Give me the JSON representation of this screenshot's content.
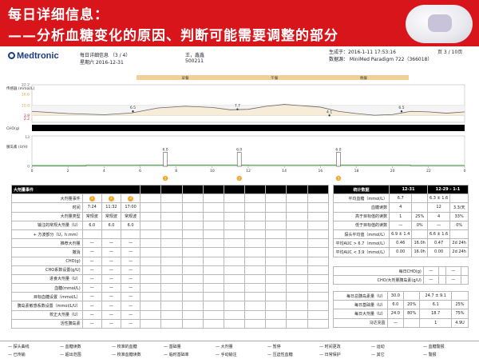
{
  "banner": {
    "line1": "每日详细信息：",
    "line2": "——分析血糖变化的原因、判断可能需要调整的部分"
  },
  "header": {
    "logo": "Medtronic",
    "report_title": "每日详细信息 （3 / 4）",
    "weekday_date": "星期六  2016-12-31",
    "patient_name": "王，鑫鑫",
    "patient_id": "500211",
    "generated": "生成于：2016-1-11 17:53:16",
    "page": "页 3 / 10页",
    "data_source": "数据源：  MiniMed Paradigm 722（366018）"
  },
  "chart_data": {
    "type": "line",
    "meal_bands": [
      "早餐",
      "午餐",
      "晚餐"
    ],
    "sg_ylabel": "传感器 (mmol/L)",
    "sg_ticks": [
      "22.2",
      "16.6",
      "10.0",
      "3.9",
      "2.2"
    ],
    "sg_ylim": [
      0,
      22.2
    ],
    "sg_x": [
      0,
      2,
      4,
      5.5,
      7,
      8.5,
      10,
      11,
      12,
      13,
      14,
      16,
      17,
      18,
      19,
      20,
      21,
      22,
      23,
      24
    ],
    "sg_y": [
      6.5,
      5.2,
      4.5,
      5.5,
      8.5,
      9.5,
      8.8,
      7.4,
      7.7,
      9.5,
      10.6,
      9.0,
      6.5,
      5.2,
      4.2,
      4.6,
      6.5,
      6.2,
      5.4,
      6.2
    ],
    "bg_points": [
      {
        "x": 5.6,
        "y": 6.5,
        "label": "6.5"
      },
      {
        "x": 11.4,
        "y": 7.7,
        "label": "7.7"
      },
      {
        "x": 16.5,
        "y": 4.1,
        "label": "4.1"
      },
      {
        "x": 20.5,
        "y": 6.5,
        "label": "6.5"
      }
    ],
    "carb_label": "CHO(g)",
    "insulin_ylabel": "胰岛素 (U/H)",
    "insulin_ticks": [
      "13",
      "0"
    ],
    "insulin_ylim": [
      0,
      13
    ],
    "basal": [
      0.3,
      0.3,
      0.3,
      0.45,
      0.45,
      0.45,
      0.55,
      0.55,
      0.55,
      0.5,
      0.5,
      0.5,
      0.45,
      0.45,
      0.45,
      0.45,
      0.55,
      0.55,
      0.5,
      0.5,
      0.5,
      0.35,
      0.35,
      0.35
    ],
    "boluses": [
      {
        "x": 7.4,
        "value": 6.0,
        "label": "6.0"
      },
      {
        "x": 11.5,
        "value": 6.0,
        "label": "6.0"
      },
      {
        "x": 17.0,
        "value": 6.0,
        "label": "6.0"
      }
    ],
    "x_ticks": [
      "0",
      "2",
      "4",
      "6",
      "8",
      "10",
      "12",
      "14",
      "16",
      "18",
      "20",
      "22",
      "0"
    ],
    "event_markers": [
      "1",
      "2",
      "3"
    ]
  },
  "left_table": {
    "title": "大剂量事件",
    "rows": [
      {
        "label": "大剂量事件",
        "v": [
          "1",
          "2",
          "3"
        ]
      },
      {
        "label": "时间",
        "v": [
          "7:24",
          "11:32",
          "17:00"
        ]
      },
      {
        "label": "大剂量类型",
        "v": [
          "常规波",
          "常规波",
          "常规波"
        ]
      },
      {
        "label": "输注的常规大剂量（U）",
        "v": [
          "6.0",
          "6.0",
          "6.0"
        ]
      },
      {
        "label": "+ 方波部分（U，h:mm）",
        "v": [
          "",
          "",
          ""
        ]
      },
      {
        "label": "推荐大剂量",
        "v": [
          "—",
          "—",
          "—"
        ]
      },
      {
        "label": "撤消",
        "v": [
          "—",
          "—",
          "—"
        ]
      },
      {
        "label": "CHO(g)",
        "v": [
          "—",
          "—",
          "—"
        ]
      },
      {
        "label": "CHO系数设置(g/U)",
        "v": [
          "—",
          "—",
          "—"
        ]
      },
      {
        "label": "进食大剂量（U）",
        "v": [
          "—",
          "—",
          "—"
        ]
      },
      {
        "label": "血糖(mmol/L)",
        "v": [
          "—",
          "—",
          "—"
        ]
      },
      {
        "label": "目标血糖设置（mmol/L）",
        "v": [
          "—",
          "—",
          "—"
        ]
      },
      {
        "label": "胰岛素敏感系数设置（mmol/L/U）",
        "v": [
          "—",
          "—",
          "—"
        ]
      },
      {
        "label": "校正大剂量（U）",
        "v": [
          "—",
          "—",
          "—"
        ]
      },
      {
        "label": "活性胰岛素",
        "v": [
          "—",
          "—",
          "—"
        ]
      }
    ]
  },
  "right_stats": {
    "title": "统计数据",
    "col1": "12-31",
    "col2": "12-29 - 1-1",
    "rows": [
      {
        "label": "平均血糖（mmol/L）",
        "a": "6.7",
        "b": "",
        "c": "6.3 ± 1.6",
        "d": ""
      },
      {
        "label": "血糖读数",
        "a": "4",
        "b": "",
        "c": "12",
        "d": "3.3/天"
      },
      {
        "label": "高于目标值的读数",
        "a": "1",
        "b": "25%",
        "c": "4",
        "d": "33%"
      },
      {
        "label": "低于目标值的读数",
        "a": "—",
        "b": "0%",
        "c": "—",
        "d": "0%"
      },
      {
        "label": "探头平均值（mmol/L）",
        "a": "6.9 ± 1.4",
        "b": "",
        "c": "6.6 ± 1.6",
        "d": ""
      },
      {
        "label": "平均AUC > 6.7（mmol/L）",
        "a": "0.46",
        "b": "16.0h",
        "c": "0.47",
        "d": "2d 24h"
      },
      {
        "label": "平均AUC < 3.9（mmol/L）",
        "a": "0.00",
        "b": "16.0h",
        "c": "0.00",
        "d": "2d 24h"
      }
    ],
    "cho_rows": [
      {
        "label": "每日CHO(g)",
        "a": "—",
        "b": "",
        "c": "—",
        "d": ""
      },
      {
        "label": "CHO/大剂量胰岛素(g/U)",
        "a": "—",
        "b": "",
        "c": "—",
        "d": ""
      }
    ],
    "insulin_rows": [
      {
        "label": "每日总胰岛素量（U）",
        "a": "30.0",
        "b": "",
        "c": "24.7 ± 9.1",
        "d": ""
      },
      {
        "label": "每日基础量（U）",
        "a": "6.0",
        "b": "20%",
        "c": "6.1",
        "d": "25%"
      },
      {
        "label": "每日大剂量（U）",
        "a": "24.0",
        "b": "80%",
        "c": "18.7",
        "d": "75%"
      },
      {
        "label": "马达充盈",
        "a": "—",
        "b": "",
        "c": "1",
        "d": "4.9U"
      }
    ]
  },
  "legend": {
    "row1": [
      "探头曲线",
      "血糖读数",
      "校准的血糖",
      "基础量",
      "大剂量",
      "暂停",
      "时间更改",
      "运动",
      "血糖警报"
    ],
    "row2": [
      "已传输",
      "超出范围",
      "校准血糖读数",
      "临时基础率",
      "手动输注",
      "压迫性血糖",
      "日常保护",
      "其它",
      "警报"
    ]
  }
}
